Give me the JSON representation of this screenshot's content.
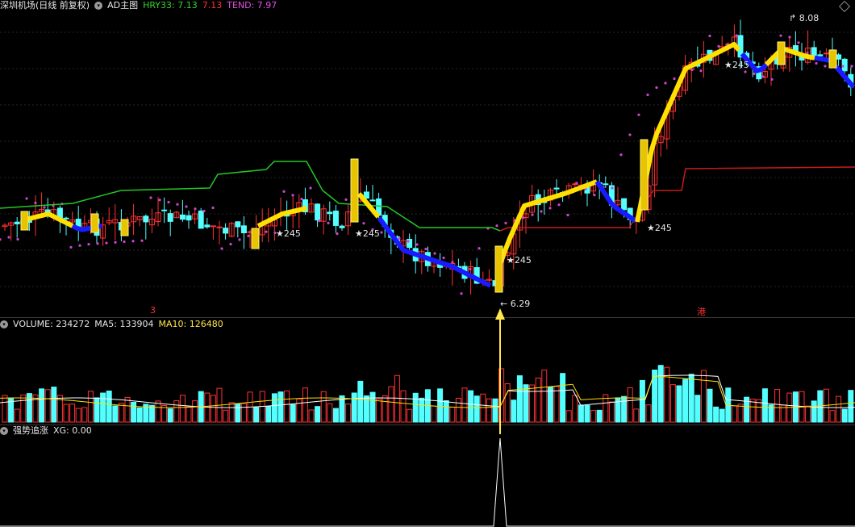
{
  "main_header": {
    "title": "深圳机场(日线 前复权)",
    "indicator": "AD主图",
    "hry_label": "HRY33: 7.13",
    "mid_label": "7.13",
    "tend_label": "TEND: 7.97"
  },
  "main_chart": {
    "price_range": [
      6.0,
      8.5
    ],
    "high_label": "8.08",
    "low_label": "6.29",
    "star_label": "★245",
    "red_markers": [
      "3",
      "港"
    ]
  },
  "volume_header": {
    "volume_label": "VOLUME: 234272",
    "ma5_label": "MA5: 133904",
    "ma10_label": "MA10: 126480"
  },
  "signal_header": {
    "name": "强势追涨",
    "xg_label": "XG: 0.00"
  },
  "colors": {
    "up": "#ff3232",
    "down": "#54ffff",
    "ma_yellow": "#ffe000",
    "dots": "#d044d0",
    "trend_down": "#1a1aff",
    "line_green": "#23c823",
    "line_red": "#c81a1a",
    "signal": "#ffe84c"
  }
}
